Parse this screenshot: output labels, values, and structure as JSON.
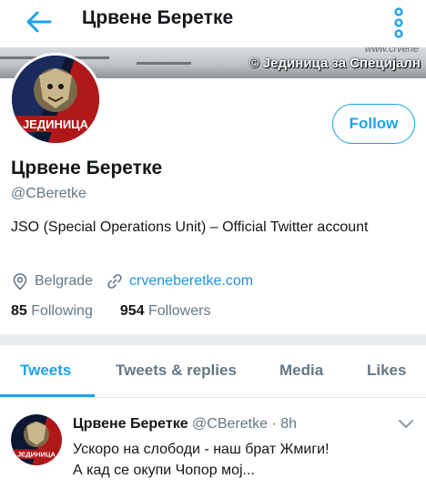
{
  "header": {
    "title": "Црвене Беретке",
    "back_icon": "arrow-left-icon",
    "more_icon": "vertical-dots-icon",
    "accent": "#1da1f2"
  },
  "banner": {
    "url": "www.crvene",
    "credit": "© Јединица за Специјалн"
  },
  "profile": {
    "avatar_text": "ЈЕДИНИЦА",
    "follow_label": "Follow",
    "name": "Црвене Беретке",
    "handle": "@CBeretke",
    "bio": "JSO (Special Operations Unit) –  Official Twitter account",
    "location": "Belgrade",
    "website": "crveneberetke.com",
    "following_count": "85",
    "following_label": "Following",
    "followers_count": "954",
    "followers_label": "Followers"
  },
  "tabs": [
    {
      "label": "Tweets",
      "active": true
    },
    {
      "label": "Tweets & replies",
      "active": false
    },
    {
      "label": "Media",
      "active": false
    },
    {
      "label": "Likes",
      "active": false
    }
  ],
  "tweet": {
    "author": "Црвене Беретке",
    "handle": "@CBeretke",
    "separator": "·",
    "time": "8h",
    "avatar_text": "ЈЕДИНИЦА",
    "line1": "Ускоро на слободи - наш брат Жмиги!",
    "line2": "А кад се окупи Чопор мој..."
  }
}
